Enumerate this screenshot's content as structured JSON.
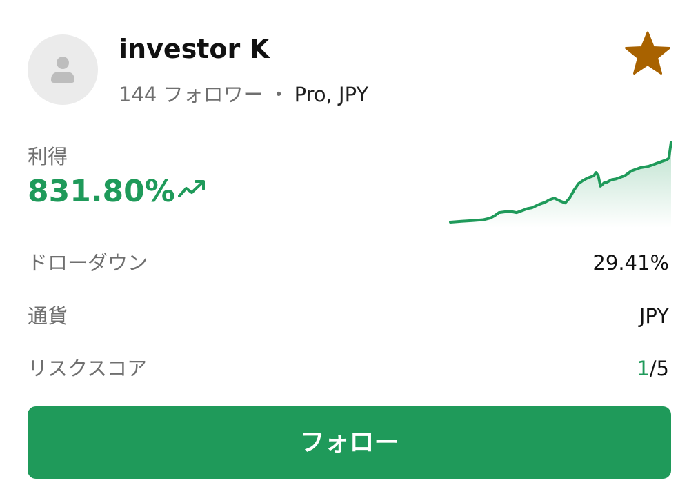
{
  "profile": {
    "name": "investor K",
    "followers": "144 フォロワー",
    "separator": "・",
    "plan": "Pro, JPY"
  },
  "favorite": {
    "icon": "star-icon",
    "color": "#A86200"
  },
  "profit": {
    "label": "利得",
    "value": "831.80%",
    "icon": "trending-up-icon"
  },
  "chart_data": {
    "type": "area",
    "title": "",
    "xlabel": "",
    "ylabel": "",
    "grid": false,
    "axes_visible": false,
    "x": [
      0,
      5,
      10,
      15,
      18,
      20,
      22,
      25,
      28,
      30,
      33,
      35,
      37,
      40,
      43,
      45,
      47,
      50,
      52,
      54,
      56,
      57,
      58,
      60,
      62,
      63,
      64,
      65,
      66,
      67,
      68,
      70,
      71,
      73,
      75,
      77,
      79,
      80,
      82,
      84,
      85,
      86,
      88,
      90,
      92,
      93,
      95,
      96,
      97,
      98,
      99,
      100
    ],
    "values": [
      0,
      1,
      2,
      3,
      5,
      8,
      12,
      13,
      13,
      12,
      15,
      17,
      18,
      22,
      25,
      28,
      30,
      26,
      24,
      30,
      40,
      44,
      48,
      52,
      55,
      56,
      57,
      58,
      62,
      58,
      45,
      50,
      50,
      53,
      54,
      56,
      58,
      60,
      64,
      66,
      67,
      68,
      69,
      70,
      72,
      73,
      75,
      76,
      77,
      78,
      80,
      100
    ],
    "line_color": "#1F9A5A",
    "fill_color": "#1F9A5A"
  },
  "stats": [
    {
      "label": "ドローダウン",
      "value": "29.41%"
    },
    {
      "label": "通貨",
      "value": "JPY"
    },
    {
      "label": "リスクスコア",
      "value_highlight": "1",
      "value_rest": "/5"
    }
  ],
  "follow_button": {
    "label": "フォロー",
    "color": "#1F9A5A"
  },
  "colors": {
    "positive": "#1F9A5A",
    "muted_text": "#6F6F6F",
    "avatar_bg": "#EBEBEB",
    "avatar_glyph": "#BDBDBD"
  }
}
